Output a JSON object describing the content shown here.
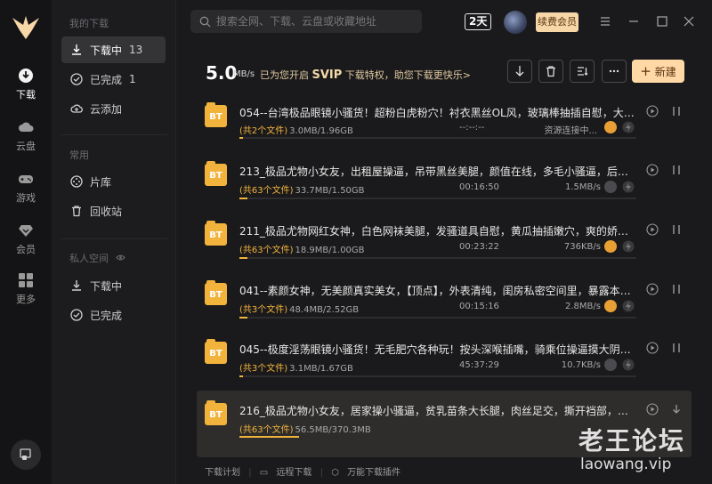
{
  "app": {
    "watermark_cn": "老王论坛",
    "watermark_url": "laowang.vip"
  },
  "rail": {
    "items": [
      {
        "label": "下载",
        "icon": "download-circle-icon",
        "active": true
      },
      {
        "label": "云盘",
        "icon": "cloud-icon"
      },
      {
        "label": "游戏",
        "icon": "gamepad-icon"
      },
      {
        "label": "会员",
        "icon": "diamond-icon"
      },
      {
        "label": "更多",
        "icon": "grid-icon"
      }
    ]
  },
  "sidebar": {
    "my_downloads_caption": "我的下载",
    "items": [
      {
        "label": "下载中",
        "count": "13",
        "active": true
      },
      {
        "label": "已完成",
        "count": "1"
      },
      {
        "label": "云添加",
        "count": ""
      }
    ],
    "common_caption": "常用",
    "common_items": [
      {
        "label": "片库"
      },
      {
        "label": "回收站"
      }
    ],
    "private_caption": "私人空间",
    "private_items": [
      {
        "label": "下载中"
      },
      {
        "label": "已完成"
      }
    ]
  },
  "topbar": {
    "search_placeholder": "搜索全网、下载、云盘或收藏地址",
    "days_badge": "2天",
    "renew_label": "续费会员"
  },
  "header": {
    "speed": "5.0",
    "speed_unit": "MB/s",
    "promo_prefix": "已为您开启",
    "promo_svip": "SVIP",
    "promo_suffix": "下载特权，助您下载更快乐>",
    "new_button": "新建"
  },
  "tasks": [
    {
      "title": "054--台湾极品眼镜小骚货！超粉白虎粉穴！衬衣黑丝OL风，玻璃棒抽插自慰，大黑牛震穴，爽...",
      "files": "(共2个文件)",
      "size": "3.0MB/1.96GB",
      "time": "--:--:--",
      "speed": "资源连接中...",
      "progress": 0.0,
      "accel": true
    },
    {
      "title": "213_极品尤物小女友，出租屋操逼，吊带黑丝美腿，颜值在线，多毛小骚逼，后入爆草美臀，...",
      "files": "(共63个文件)",
      "size": "33.7MB/1.50GB",
      "time": "00:16:50",
      "speed": "1.5MB/s",
      "progress": 0.02,
      "accel": false
    },
    {
      "title": "211_极品尤物网红女神，白色网袜美腿，发骚道具自慰，黄瓜抽插嫩穴，爽的娇喘呻吟，美女...",
      "files": "(共63个文件)",
      "size": "18.9MB/1.00GB",
      "time": "00:23:22",
      "speed": "736KB/s",
      "progress": 0.02,
      "accel": true
    },
    {
      "title": "041--素颜女神，无美颜真实美女，【顶点】，外表清纯，闺房私密空间里，暴露本性，骚的一...",
      "files": "(共3个文件)",
      "size": "48.4MB/2.52GB",
      "time": "00:15:16",
      "speed": "2.8MB/s",
      "progress": 0.02,
      "accel": true
    },
    {
      "title": "045--极度淫荡眼镜小骚货！无毛肥穴各种玩！按头深喉插嘴，骑乘位操逼摸大阴蒂，操完自摸...",
      "files": "(共3个文件)",
      "size": "3.1MB/1.67GB",
      "time": "45:37:29",
      "speed": "10.7KB/s",
      "progress": 0.002,
      "accel": false
    },
    {
      "title": "216_极品尤物小女友，居家操小骚逼，贫乳苗条大长腿，肉丝足交，撕开裆部，多毛骚逼，怼...",
      "files": "(共63个文件)",
      "size": "56.5MB/370.3MB",
      "time": "",
      "speed": "",
      "progress": 0.15,
      "accel": false
    }
  ],
  "footer": {
    "items": [
      "下载计划",
      "远程下载",
      "万能下载插件"
    ]
  }
}
